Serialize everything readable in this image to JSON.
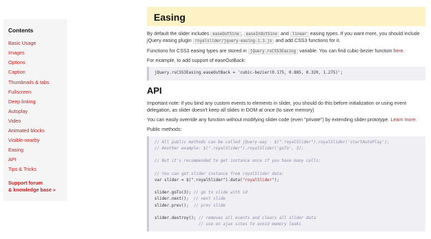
{
  "sidebar": {
    "title": "Contents",
    "items": [
      "Basic Usage",
      "Images",
      "Options",
      "Caption",
      "Thumbnails & tabs",
      "Fullscreen",
      "Deep linking",
      "Autoplay",
      "Video",
      "Animated blocks",
      "Visible-nearby",
      "Easing",
      "API",
      "Tips & Tricks"
    ],
    "support_line1": "Support forum",
    "support_line2": "& knowledge base »"
  },
  "easing": {
    "heading": "Easing",
    "p1_a": "By default the slider includes",
    "code1": "easeOutSine",
    "p1_comma": ",",
    "code2": "easeInOutSine",
    "p1_and": "and",
    "code3": "linear",
    "p1_b": "easing types. If you want more, you should include jQuery easing plugin",
    "code4": "royalslider/jquery-easing-1.3.js",
    "p1_c": "and add CSS3 functions for it.",
    "p2_a": "Functions for CSS3 easing types are stored in",
    "code5": "jQuery.rsCSS3Easing",
    "p2_b": "variable. You can find cubic-bezier function",
    "p2_link": "here.",
    "p3": "For example, to add support of easeOutBack:",
    "code_block": "jQuery.rsCSS3Easing.easeOutBack = 'cubic-bezier(0.175, 0.885, 0.320, 1.275)';"
  },
  "api": {
    "heading": "API",
    "p1": "Important note: if you bind any custom events to elements in slider, you should do this before initialization or using event delegation, as slider doesn't keep all slides in DOM at once (to save memory)",
    "p2_a": "You can easily override any function without modifying slider code (even \"private\") by extending slider prototype.",
    "p2_link": "Learn more.",
    "p3": "Public methods:",
    "code": {
      "l1": "// All public methods can be called jQuery-way - $(\".royalSlider\").royalSlider('startAutoPlay');",
      "l2": "// Another example: $(\".royalSlider\").royalSlider('goTo', 3);",
      "l3": "// But it's recommended to get instance once if you have many calls:",
      "l4": "// You can get slider instance from royalSlider data:",
      "l5a": "var slider = $(\".royalSlider\").data(",
      "l5s": "\"royalSlider\"",
      "l5b": ");",
      "l6a": "slider.goTo(3); ",
      "l6c": "// go to slide with id",
      "l7a": "slider.next();  ",
      "l7c": "// next slide",
      "l8a": "slider.prev();  ",
      "l8c": "// prev slide",
      "l9a": "slider.destroy(); ",
      "l9c": "// removes all events and clears all slider data",
      "l10": "                  // use on ajax sites to avoid memory leaks"
    }
  }
}
